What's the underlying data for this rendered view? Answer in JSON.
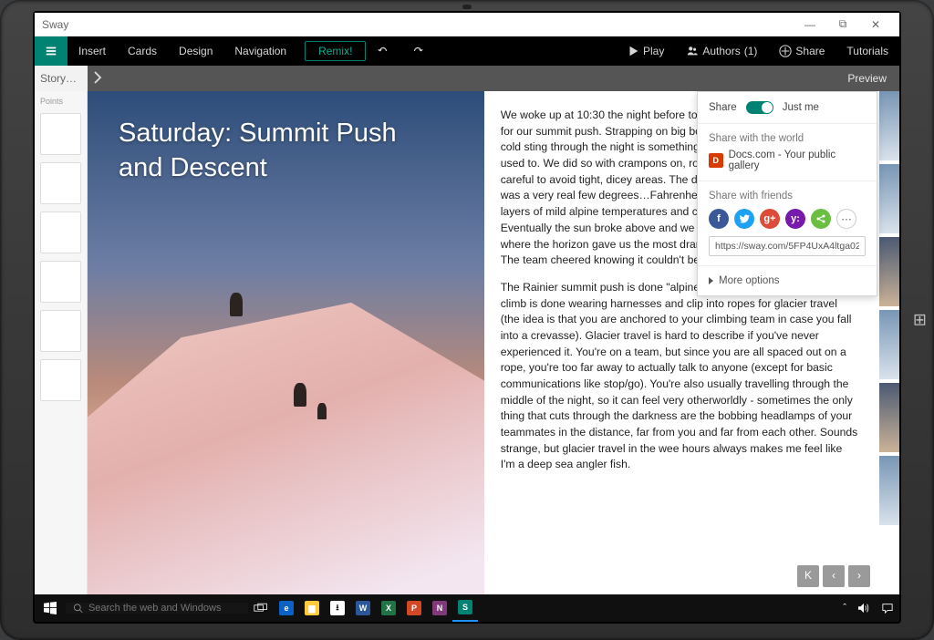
{
  "window": {
    "title": "Sway",
    "minimize": "—",
    "maximize": "⧉",
    "close": "✕"
  },
  "ribbon": {
    "items": [
      "Insert",
      "Cards",
      "Design",
      "Navigation"
    ],
    "remix": "Remix!",
    "play": "Play",
    "authors_label": "Authors",
    "authors_count": "(1)",
    "share": "Share",
    "tutorials": "Tutorials"
  },
  "tabstrip": {
    "storyline": "Story…",
    "preview": "Preview"
  },
  "sidepanel": {
    "heading": "Points"
  },
  "hero": {
    "title_line1": "Saturday: Summit Push",
    "title_line2": "and Descent"
  },
  "article": {
    "p1": "We woke up at 10:30 the night before to prep all our gear and our minds for our summit push. Strapping on big boots in near darkness and the cold sting through the night is something I don't think I'll ever really get used to. We did so with crampons on, roped together under lamplight, careful to avoid tight, dicey areas. The distance wasn't far, but the cold was a very real few degrees…Fahrenheit. We passed through several layers of mild alpine temperatures and cold zones as we ascended. Eventually the sun broke above and we began our steep uphill climb where the horizon gave us the most dramatic view of the valley below. The team cheered knowing it couldn't be past 5.",
    "p2": "The Rainier summit push is done \"alpine style,\" meaning this part of the climb is done wearing harnesses and clip into ropes for glacier travel (the idea is that you are anchored to your climbing team in case you fall into a crevasse). Glacier travel is hard to describe if you've never experienced it. You're on a team, but since you are all spaced out on a rope, you're too far away to actually talk to anyone (except for basic communications like stop/go). You're also usually travelling through the middle of the night, so it can feel very otherworldly - sometimes the only thing that cuts through the darkness are the bobbing headlamps of your teammates in the distance, far from you and far from each other. Sounds strange, but glacier travel in the wee hours always makes me feel like I'm a deep sea angler fish."
  },
  "pager": {
    "k": "K",
    "prev": "‹",
    "next": "›"
  },
  "share_panel": {
    "share_label": "Share",
    "scope": "Just me",
    "world_label": "Share with the world",
    "docs_label": "Docs.com - Your public gallery",
    "friends_label": "Share with friends",
    "url": "https://sway.com/5FP4UxA4ltga02",
    "more": "More options"
  },
  "taskbar": {
    "search_placeholder": "Search the web and Windows"
  },
  "colors": {
    "accent": "#008272"
  }
}
